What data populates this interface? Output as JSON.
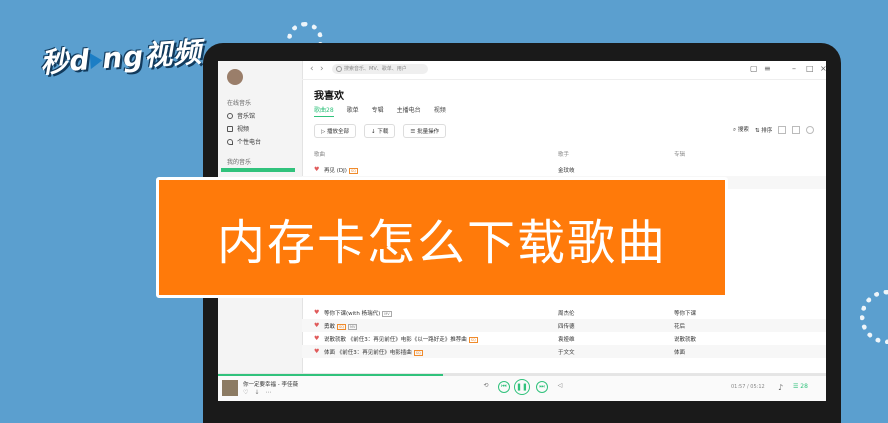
{
  "logo": {
    "text_left": "秒d",
    "text_right": "ng视频",
    "play_icon": "play-triangle-icon"
  },
  "overlay": {
    "title": "内存卡怎么下载歌曲",
    "background": "#ff7a0a"
  },
  "app": {
    "accent": "#31c27c",
    "search": {
      "placeholder": "搜索音乐、MV、歌单、用户"
    },
    "sidebar": {
      "section_online": "在线音乐",
      "items": [
        {
          "label": "音乐馆",
          "icon": "music-hall-icon"
        },
        {
          "label": "视频",
          "icon": "video-icon"
        },
        {
          "label": "个性电台",
          "icon": "radio-icon"
        }
      ],
      "section_mine": "我的音乐"
    },
    "page_title": "我喜欢",
    "tabs": [
      "歌曲28",
      "歌单",
      "专辑",
      "主播电台",
      "视频"
    ],
    "toolbar": {
      "play_all": "播放全部",
      "download": "下载",
      "batch": "批量操作",
      "search": "搜索",
      "sort": "排序"
    },
    "columns": {
      "song": "歌曲",
      "singer": "歌手",
      "album": "专辑"
    },
    "rows_top": [
      {
        "song": "再见 (DJ)",
        "singer": "金玟岐",
        "album": ""
      }
    ],
    "rows_bottom": [
      {
        "song": "等你下课(with 杨瑞代)",
        "singer": "周杰伦",
        "album": "等你下课"
      },
      {
        "song": "勇敢",
        "singer": "四传德",
        "album": "花后"
      },
      {
        "song": "说散就散 《前任3：再见前任》电影《以一路好走》推荐曲",
        "singer": "袁娅维",
        "album": "说散就散"
      },
      {
        "song": "体面 《前任3：再见前任》电影插曲",
        "singer": "于文文",
        "album": "体面"
      }
    ],
    "player": {
      "now_playing": "你一定要幸福 - 李佳薇",
      "time": "01:57 / 05:12",
      "playlist_count": "28",
      "progress": 0.37
    }
  }
}
